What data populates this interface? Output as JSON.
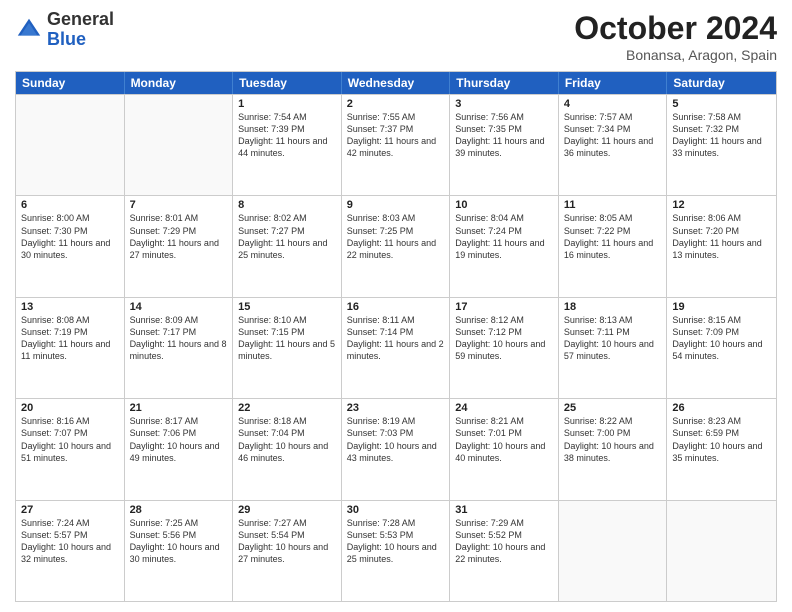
{
  "header": {
    "logo_general": "General",
    "logo_blue": "Blue",
    "title": "October 2024",
    "subtitle": "Bonansa, Aragon, Spain"
  },
  "weekdays": [
    "Sunday",
    "Monday",
    "Tuesday",
    "Wednesday",
    "Thursday",
    "Friday",
    "Saturday"
  ],
  "rows": [
    [
      {
        "day": "",
        "info": "",
        "empty": true
      },
      {
        "day": "",
        "info": "",
        "empty": true
      },
      {
        "day": "1",
        "info": "Sunrise: 7:54 AM\nSunset: 7:39 PM\nDaylight: 11 hours and 44 minutes."
      },
      {
        "day": "2",
        "info": "Sunrise: 7:55 AM\nSunset: 7:37 PM\nDaylight: 11 hours and 42 minutes."
      },
      {
        "day": "3",
        "info": "Sunrise: 7:56 AM\nSunset: 7:35 PM\nDaylight: 11 hours and 39 minutes."
      },
      {
        "day": "4",
        "info": "Sunrise: 7:57 AM\nSunset: 7:34 PM\nDaylight: 11 hours and 36 minutes."
      },
      {
        "day": "5",
        "info": "Sunrise: 7:58 AM\nSunset: 7:32 PM\nDaylight: 11 hours and 33 minutes."
      }
    ],
    [
      {
        "day": "6",
        "info": "Sunrise: 8:00 AM\nSunset: 7:30 PM\nDaylight: 11 hours and 30 minutes."
      },
      {
        "day": "7",
        "info": "Sunrise: 8:01 AM\nSunset: 7:29 PM\nDaylight: 11 hours and 27 minutes."
      },
      {
        "day": "8",
        "info": "Sunrise: 8:02 AM\nSunset: 7:27 PM\nDaylight: 11 hours and 25 minutes."
      },
      {
        "day": "9",
        "info": "Sunrise: 8:03 AM\nSunset: 7:25 PM\nDaylight: 11 hours and 22 minutes."
      },
      {
        "day": "10",
        "info": "Sunrise: 8:04 AM\nSunset: 7:24 PM\nDaylight: 11 hours and 19 minutes."
      },
      {
        "day": "11",
        "info": "Sunrise: 8:05 AM\nSunset: 7:22 PM\nDaylight: 11 hours and 16 minutes."
      },
      {
        "day": "12",
        "info": "Sunrise: 8:06 AM\nSunset: 7:20 PM\nDaylight: 11 hours and 13 minutes."
      }
    ],
    [
      {
        "day": "13",
        "info": "Sunrise: 8:08 AM\nSunset: 7:19 PM\nDaylight: 11 hours and 11 minutes."
      },
      {
        "day": "14",
        "info": "Sunrise: 8:09 AM\nSunset: 7:17 PM\nDaylight: 11 hours and 8 minutes."
      },
      {
        "day": "15",
        "info": "Sunrise: 8:10 AM\nSunset: 7:15 PM\nDaylight: 11 hours and 5 minutes."
      },
      {
        "day": "16",
        "info": "Sunrise: 8:11 AM\nSunset: 7:14 PM\nDaylight: 11 hours and 2 minutes."
      },
      {
        "day": "17",
        "info": "Sunrise: 8:12 AM\nSunset: 7:12 PM\nDaylight: 10 hours and 59 minutes."
      },
      {
        "day": "18",
        "info": "Sunrise: 8:13 AM\nSunset: 7:11 PM\nDaylight: 10 hours and 57 minutes."
      },
      {
        "day": "19",
        "info": "Sunrise: 8:15 AM\nSunset: 7:09 PM\nDaylight: 10 hours and 54 minutes."
      }
    ],
    [
      {
        "day": "20",
        "info": "Sunrise: 8:16 AM\nSunset: 7:07 PM\nDaylight: 10 hours and 51 minutes."
      },
      {
        "day": "21",
        "info": "Sunrise: 8:17 AM\nSunset: 7:06 PM\nDaylight: 10 hours and 49 minutes."
      },
      {
        "day": "22",
        "info": "Sunrise: 8:18 AM\nSunset: 7:04 PM\nDaylight: 10 hours and 46 minutes."
      },
      {
        "day": "23",
        "info": "Sunrise: 8:19 AM\nSunset: 7:03 PM\nDaylight: 10 hours and 43 minutes."
      },
      {
        "day": "24",
        "info": "Sunrise: 8:21 AM\nSunset: 7:01 PM\nDaylight: 10 hours and 40 minutes."
      },
      {
        "day": "25",
        "info": "Sunrise: 8:22 AM\nSunset: 7:00 PM\nDaylight: 10 hours and 38 minutes."
      },
      {
        "day": "26",
        "info": "Sunrise: 8:23 AM\nSunset: 6:59 PM\nDaylight: 10 hours and 35 minutes."
      }
    ],
    [
      {
        "day": "27",
        "info": "Sunrise: 7:24 AM\nSunset: 5:57 PM\nDaylight: 10 hours and 32 minutes."
      },
      {
        "day": "28",
        "info": "Sunrise: 7:25 AM\nSunset: 5:56 PM\nDaylight: 10 hours and 30 minutes."
      },
      {
        "day": "29",
        "info": "Sunrise: 7:27 AM\nSunset: 5:54 PM\nDaylight: 10 hours and 27 minutes."
      },
      {
        "day": "30",
        "info": "Sunrise: 7:28 AM\nSunset: 5:53 PM\nDaylight: 10 hours and 25 minutes."
      },
      {
        "day": "31",
        "info": "Sunrise: 7:29 AM\nSunset: 5:52 PM\nDaylight: 10 hours and 22 minutes."
      },
      {
        "day": "",
        "info": "",
        "empty": true
      },
      {
        "day": "",
        "info": "",
        "empty": true
      }
    ]
  ]
}
